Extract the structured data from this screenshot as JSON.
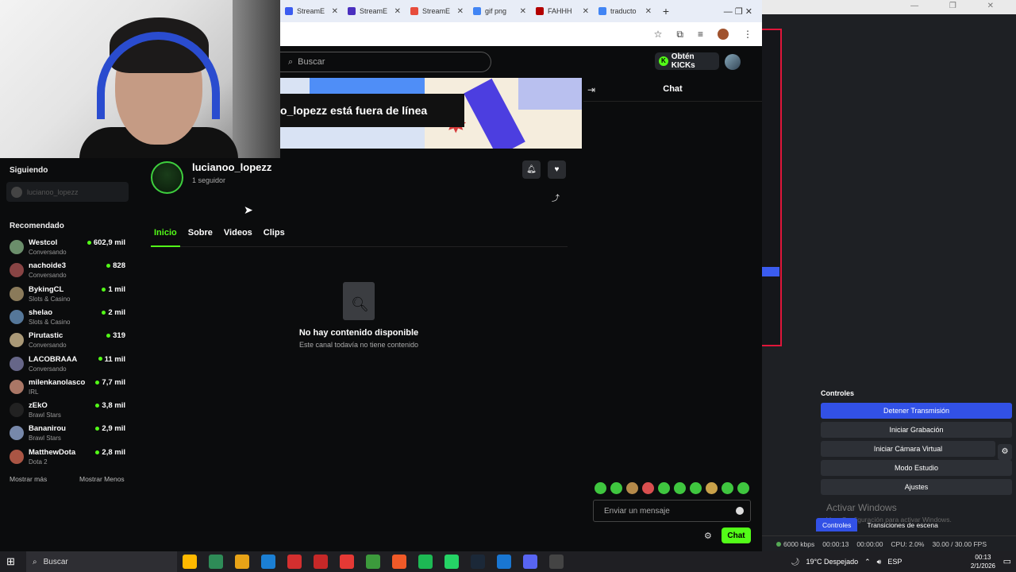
{
  "browser": {
    "tabs": [
      {
        "label": "StreamE",
        "color": "#3b5cf0"
      },
      {
        "label": "StreamE",
        "color": "#4a2fbf"
      },
      {
        "label": "StreamE",
        "color": "#e74c3c"
      },
      {
        "label": "gif png",
        "color": "#4285f4"
      },
      {
        "label": "FAHHH",
        "color": "#b30000"
      },
      {
        "label": "traducto",
        "color": "#4285f4"
      }
    ],
    "new_tab": "+",
    "win_controls": "— ❐ ✕"
  },
  "kick": {
    "search_placeholder": "Buscar",
    "get_kicks": "Obtén KICKs",
    "offline_text": "o_lopezz está fuera de línea",
    "channel_name": "lucianoo_lopezz",
    "followers": "1 seguidor",
    "tabs": [
      "Inicio",
      "Sobre",
      "Videos",
      "Clips"
    ],
    "empty_title": "No hay contenido disponible",
    "empty_sub": "Este canal todavía no tiene contenido"
  },
  "sidebar": {
    "following_title": "Siguiendo",
    "following_item": "lucianoo_lopezz",
    "recommended_title": "Recomendado",
    "recommended": [
      {
        "name": "Westcol",
        "category": "Conversando",
        "viewers": "602,9 mil",
        "color": "#6b8e6b"
      },
      {
        "name": "nachoide3",
        "category": "Conversando",
        "viewers": "828",
        "color": "#884444"
      },
      {
        "name": "BykingCL",
        "category": "Slots & Casino",
        "viewers": "1 mil",
        "color": "#8a7a5a"
      },
      {
        "name": "shelao",
        "category": "Slots & Casino",
        "viewers": "2 mil",
        "color": "#557799"
      },
      {
        "name": "Pirutastic",
        "category": "Conversando",
        "viewers": "319",
        "color": "#aa9977"
      },
      {
        "name": "LACOBRAAA",
        "category": "Conversando",
        "viewers": "11 mil",
        "color": "#666688"
      },
      {
        "name": "milenkanolasco",
        "category": "IRL",
        "viewers": "7,7 mil",
        "color": "#aa7766"
      },
      {
        "name": "zEkO",
        "category": "Brawl Stars",
        "viewers": "3,8 mil",
        "color": "#222222"
      },
      {
        "name": "Bananirou",
        "category": "Brawl Stars",
        "viewers": "2,9 mil",
        "color": "#7788aa"
      },
      {
        "name": "MatthewDota",
        "category": "Dota 2",
        "viewers": "2,8 mil",
        "color": "#aa5544"
      }
    ],
    "show_more": "Mostrar más",
    "show_less": "Mostrar Menos"
  },
  "chat": {
    "title": "Chat",
    "input_placeholder": "Enviar un mensaje",
    "send_label": "Chat"
  },
  "obs": {
    "controls_title": "Controles",
    "buttons": [
      "Detener Transmisión",
      "Iniciar Grabación",
      "Iniciar Cámara Virtual",
      "Modo Estudio",
      "Ajustes"
    ],
    "activate_windows": "Activar Windows",
    "activate_windows_sub": "Ve a Configuración para activar Windows.",
    "dock_tabs": [
      "Controles",
      "Transiciones de escena"
    ],
    "status": [
      "6000 kbps",
      "00:00:13",
      "00:00:00",
      "CPU: 2.0%",
      "30.00 / 30.00 FPS"
    ]
  },
  "taskbar": {
    "search": "Buscar",
    "weather": "19°C  Despejado",
    "lang": "ESP",
    "time": "00:13",
    "date": "2/1/2026",
    "apps": [
      "#ffb900",
      "#2e8b57",
      "#e8a317",
      "#1b7fd4",
      "#d32f2f",
      "#c62828",
      "#e53935",
      "#3c9a3c",
      "#f05a28",
      "#1db954",
      "#25d366",
      "#1b2838",
      "#1976d2",
      "#5865f2",
      "#444444"
    ]
  }
}
